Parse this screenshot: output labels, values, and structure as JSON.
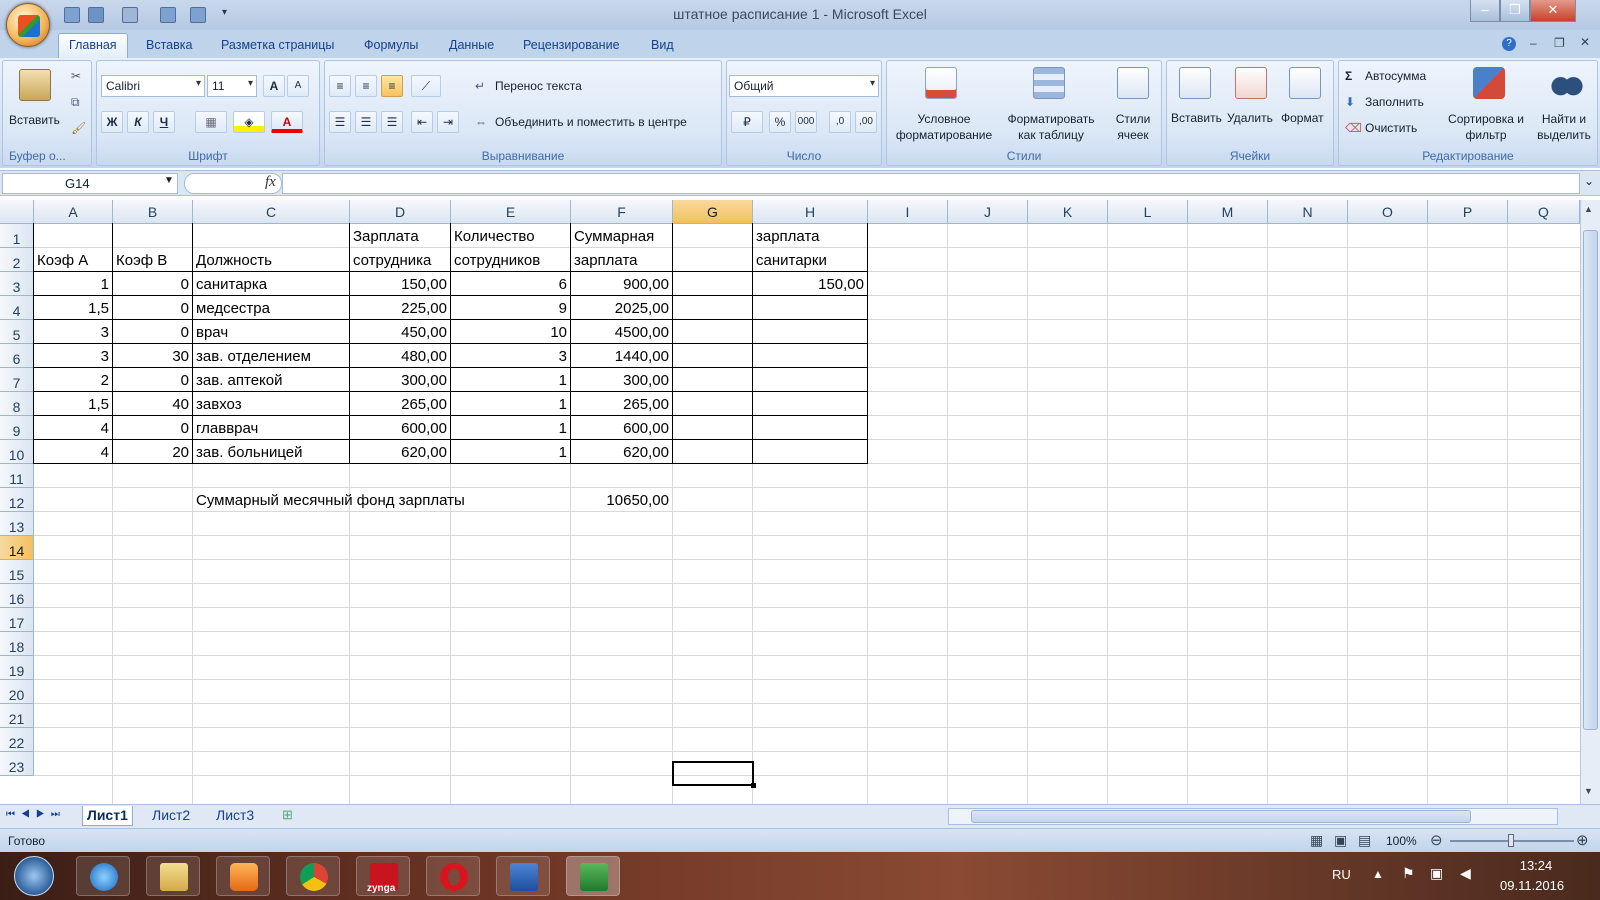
{
  "window": {
    "title": "штатное расписание 1 - Microsoft Excel",
    "minimize": "‒",
    "restore": "❐",
    "close": "✕"
  },
  "ribbon_tabs": [
    "Главная",
    "Вставка",
    "Разметка страницы",
    "Формулы",
    "Данные",
    "Рецензирование",
    "Вид"
  ],
  "ribbon": {
    "clipboard": {
      "paste": "Вставить",
      "label": "Буфер о..."
    },
    "font": {
      "name": "Calibri",
      "size": "11",
      "bold": "Ж",
      "italic": "К",
      "underline": "Ч",
      "grow": "A",
      "shrink": "A",
      "font_color_letter": "A",
      "label": "Шрифт"
    },
    "alignment": {
      "wrap": "Перенос текста",
      "merge": "Объединить и поместить в центре",
      "label": "Выравнивание"
    },
    "number": {
      "format": "Общий",
      "percent": "%",
      "thousands": "000",
      "inc": ",0",
      "dec": ",00",
      "label": "Число"
    },
    "styles": {
      "cond": "Условное форматирование",
      "table": "Форматировать как таблицу",
      "cell": "Стили ячеек",
      "label": "Стили"
    },
    "cells": {
      "insert": "Вставить",
      "delete": "Удалить",
      "format": "Формат",
      "label": "Ячейки"
    },
    "editing": {
      "autosum": "Автосумма",
      "fill": "Заполнить",
      "clear": "Очистить",
      "sort": "Сортировка и фильтр",
      "find": "Найти и выделить",
      "label": "Редактирование",
      "sigma": "Σ"
    }
  },
  "formula_bar": {
    "name_box": "G14",
    "fx": "fx",
    "content": ""
  },
  "columns": [
    "A",
    "B",
    "C",
    "D",
    "E",
    "F",
    "G",
    "H",
    "I",
    "J",
    "K",
    "L",
    "M",
    "N",
    "O",
    "P",
    "Q"
  ],
  "selected_column": "G",
  "rows": [
    "1",
    "2",
    "3",
    "4",
    "5",
    "6",
    "7",
    "8",
    "9",
    "10",
    "11",
    "12",
    "13",
    "14",
    "15",
    "16",
    "17",
    "18",
    "19",
    "20",
    "21",
    "22",
    "23"
  ],
  "selected_row": "14",
  "headers": {
    "a": "Коэф А",
    "b": "Коэф В",
    "c": "Должность",
    "d1": "Зарплата",
    "d2": "сотрудника",
    "e1": "Количество",
    "e2": "сотрудников",
    "f1": "Суммарная",
    "f2": "зарплата",
    "h1": "зарплата",
    "h2": "санитарки"
  },
  "table": [
    {
      "a": "1",
      "b": "0",
      "c": "санитарка",
      "d": "150,00",
      "e": "6",
      "f": "900,00",
      "h": "150,00"
    },
    {
      "a": "1,5",
      "b": "0",
      "c": "медсестра",
      "d": "225,00",
      "e": "9",
      "f": "2025,00",
      "h": ""
    },
    {
      "a": "3",
      "b": "0",
      "c": "врач",
      "d": "450,00",
      "e": "10",
      "f": "4500,00",
      "h": ""
    },
    {
      "a": "3",
      "b": "30",
      "c": "зав. отделением",
      "d": "480,00",
      "e": "3",
      "f": "1440,00",
      "h": ""
    },
    {
      "a": "2",
      "b": "0",
      "c": "зав. аптекой",
      "d": "300,00",
      "e": "1",
      "f": "300,00",
      "h": ""
    },
    {
      "a": "1,5",
      "b": "40",
      "c": "завхоз",
      "d": "265,00",
      "e": "1",
      "f": "265,00",
      "h": ""
    },
    {
      "a": "4",
      "b": "0",
      "c": "главврач",
      "d": "600,00",
      "e": "1",
      "f": "600,00",
      "h": ""
    },
    {
      "a": "4",
      "b": "20",
      "c": "зав. больницей",
      "d": "620,00",
      "e": "1",
      "f": "620,00",
      "h": ""
    }
  ],
  "summary": {
    "label": "Суммарный месячный фонд зарплаты",
    "value": "10650,00"
  },
  "sheets": [
    "Лист1",
    "Лист2",
    "Лист3"
  ],
  "active_sheet": "Лист1",
  "status": {
    "ready": "Готово",
    "zoom": "100%"
  },
  "taskbar": {
    "lang": "RU",
    "time": "13:24",
    "date": "09.11.2016",
    "zynga": "zynga"
  }
}
